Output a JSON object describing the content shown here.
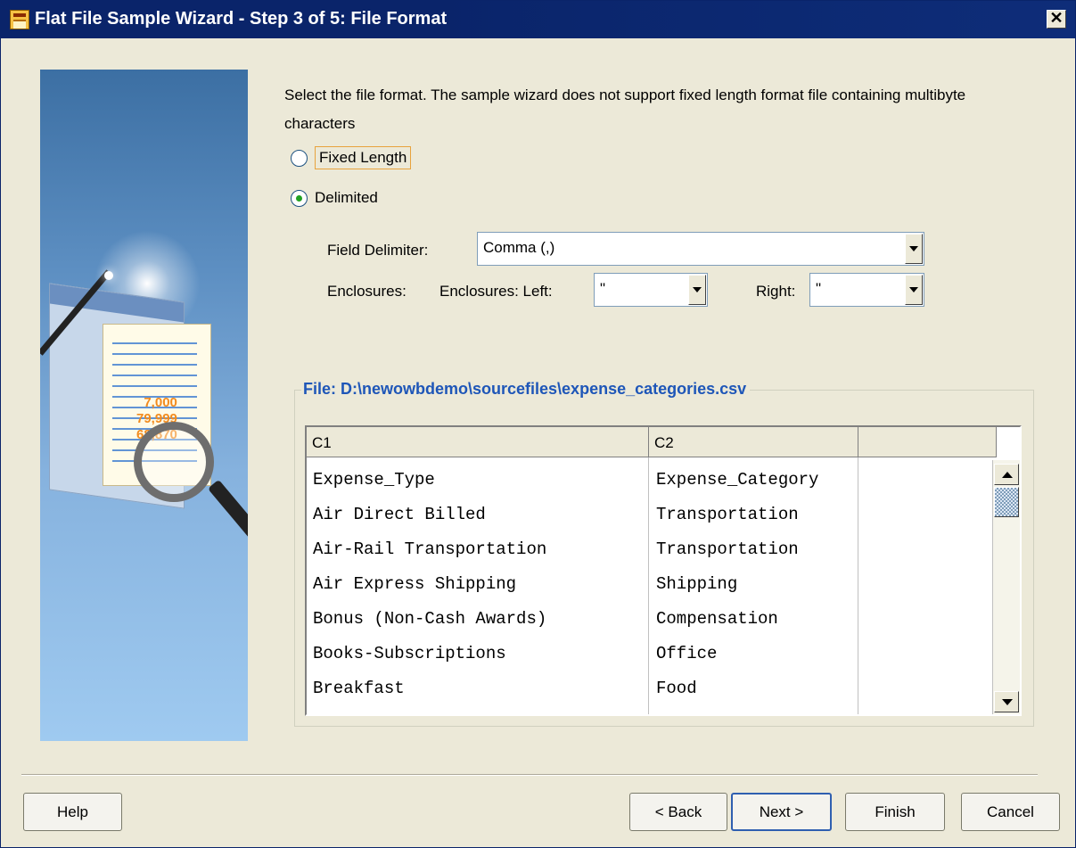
{
  "window": {
    "title": "Flat File Sample Wizard - Step 3 of 5: File Format",
    "close_glyph": "✕"
  },
  "instructions": "Select the file format. The sample wizard does not support fixed length format file containing multibyte characters",
  "format": {
    "fixed_length_label": "Fixed Length",
    "delimited_label": "Delimited",
    "selected": "Delimited"
  },
  "field_delimiter": {
    "label": "Field Delimiter:",
    "value": "Comma (,)"
  },
  "enclosures": {
    "label": "Enclosures:",
    "left_label": "Enclosures:  Left:",
    "left_value": "\"",
    "right_label": "Right:",
    "right_value": "\""
  },
  "file": {
    "label": "File: D:\\newowbdemo\\sourcefiles\\expense_categories.csv"
  },
  "grid": {
    "columns": [
      "C1",
      "C2"
    ],
    "rows": [
      [
        "Expense_Type",
        "Expense_Category"
      ],
      [
        "Air Direct Billed",
        "Transportation"
      ],
      [
        "Air-Rail Transportation",
        "Transportation"
      ],
      [
        "Air Express Shipping",
        "Shipping"
      ],
      [
        "Bonus (Non-Cash Awards)",
        "Compensation"
      ],
      [
        "Books-Subscriptions",
        "Office"
      ],
      [
        "Breakfast",
        "Food"
      ]
    ]
  },
  "buttons": {
    "help": "Help",
    "back": "< Back",
    "next": "Next >",
    "finish": "Finish",
    "cancel": "Cancel"
  },
  "side_art": {
    "numbers": [
      "7,000",
      "79,999",
      "68,870"
    ]
  }
}
